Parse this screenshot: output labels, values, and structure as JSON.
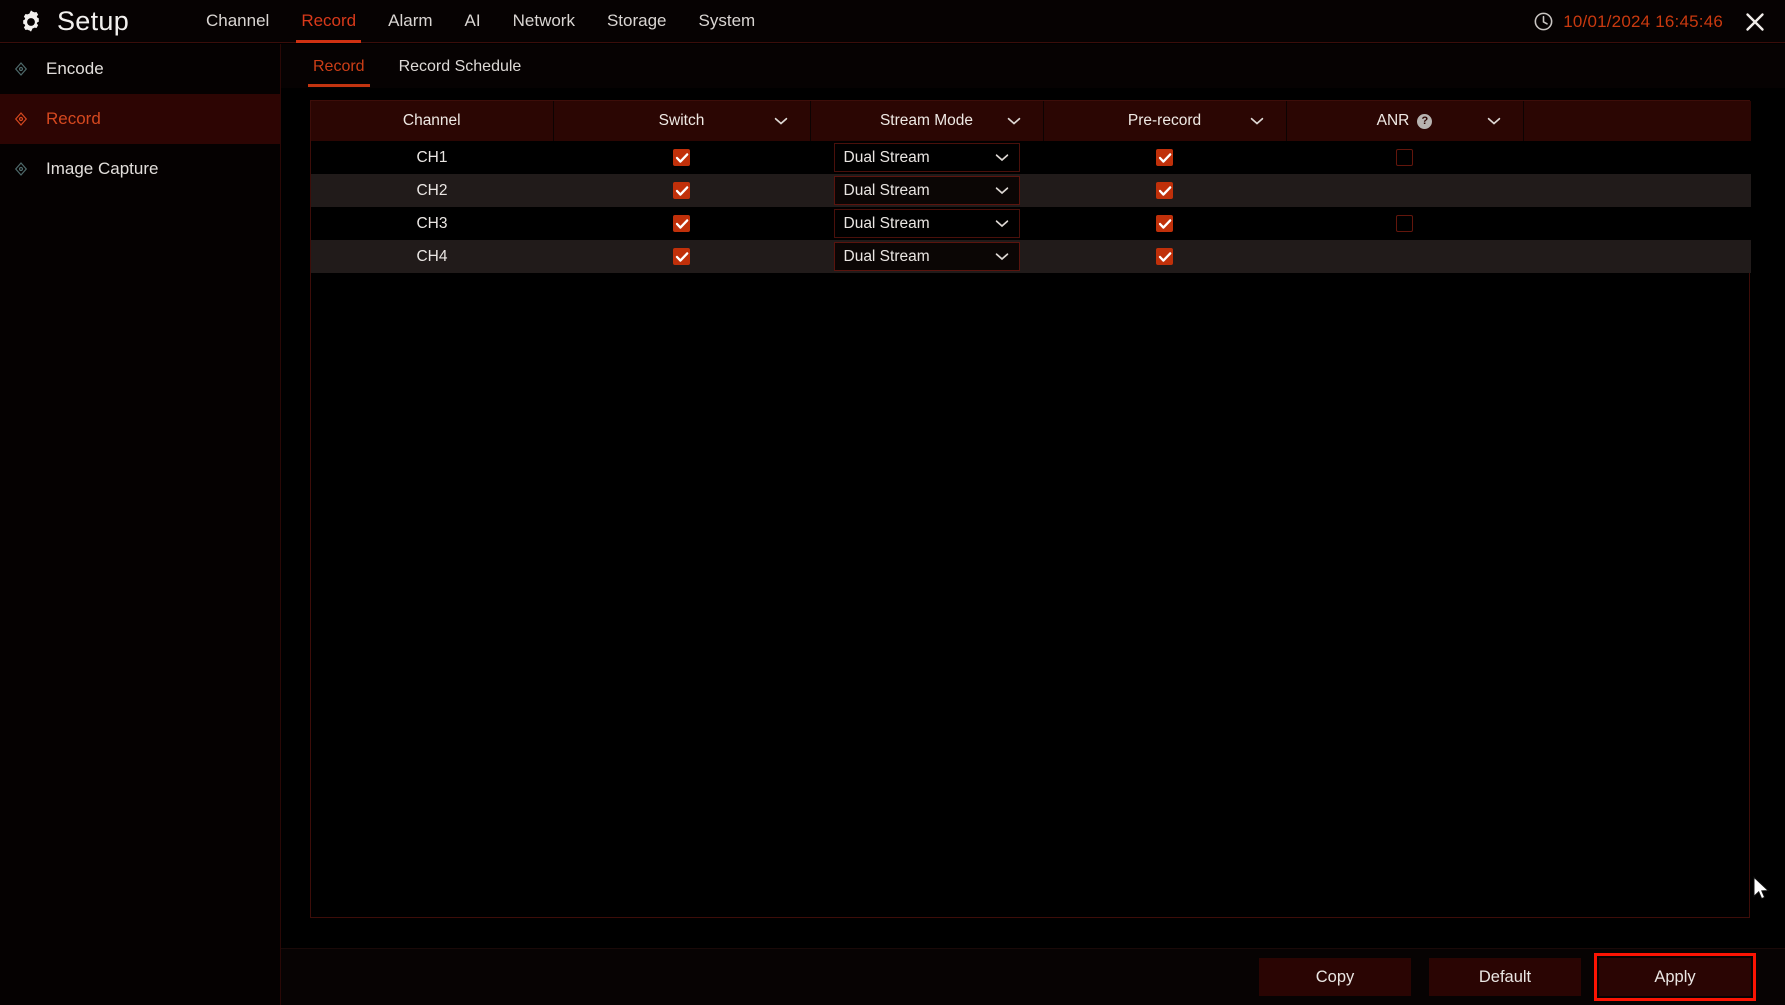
{
  "window": {
    "title": "Setup",
    "gear_icon": "gear-icon",
    "clock_icon": "clock-icon",
    "datetime": "10/01/2024 16:45:46",
    "close_icon": "close-icon",
    "accent_color": "#cc3e17",
    "checkbox_color": "#c0300a",
    "focus_color": "#fb1403"
  },
  "mainnav": {
    "items": [
      {
        "label": "Channel",
        "active": false
      },
      {
        "label": "Record",
        "active": true
      },
      {
        "label": "Alarm",
        "active": false
      },
      {
        "label": "AI",
        "active": false
      },
      {
        "label": "Network",
        "active": false
      },
      {
        "label": "Storage",
        "active": false
      },
      {
        "label": "System",
        "active": false
      }
    ]
  },
  "sidebar": {
    "items": [
      {
        "label": "Encode",
        "icon": "node-icon",
        "active": false
      },
      {
        "label": "Record",
        "icon": "node-icon",
        "active": true
      },
      {
        "label": "Image Capture",
        "icon": "node-icon",
        "active": false
      }
    ]
  },
  "subtabs": {
    "items": [
      {
        "label": "Record",
        "active": true
      },
      {
        "label": "Record Schedule",
        "active": false
      }
    ]
  },
  "table": {
    "columns": [
      {
        "label": "Channel",
        "caret": false,
        "help": false
      },
      {
        "label": "Switch",
        "caret": true,
        "help": false
      },
      {
        "label": "Stream Mode",
        "caret": true,
        "help": false
      },
      {
        "label": "Pre-record",
        "caret": true,
        "help": false
      },
      {
        "label": "ANR",
        "caret": true,
        "help": true,
        "help_icon": "question-mark-icon"
      }
    ],
    "rows": [
      {
        "channel": "CH1",
        "switch": true,
        "stream_mode": "Dual Stream",
        "pre_record": true,
        "anr": false,
        "anr_visible": true,
        "highlighted": false
      },
      {
        "channel": "CH2",
        "switch": true,
        "stream_mode": "Dual Stream",
        "pre_record": true,
        "anr": false,
        "anr_visible": false,
        "highlighted": true
      },
      {
        "channel": "CH3",
        "switch": true,
        "stream_mode": "Dual Stream",
        "pre_record": true,
        "anr": false,
        "anr_visible": true,
        "highlighted": false
      },
      {
        "channel": "CH4",
        "switch": true,
        "stream_mode": "Dual Stream",
        "pre_record": true,
        "anr": false,
        "anr_visible": false,
        "highlighted": true
      }
    ]
  },
  "footer": {
    "buttons": [
      {
        "label": "Copy",
        "focused": false
      },
      {
        "label": "Default",
        "focused": false
      },
      {
        "label": "Apply",
        "focused": true
      }
    ]
  },
  "cursor": {
    "icon": "mouse-pointer-icon"
  }
}
